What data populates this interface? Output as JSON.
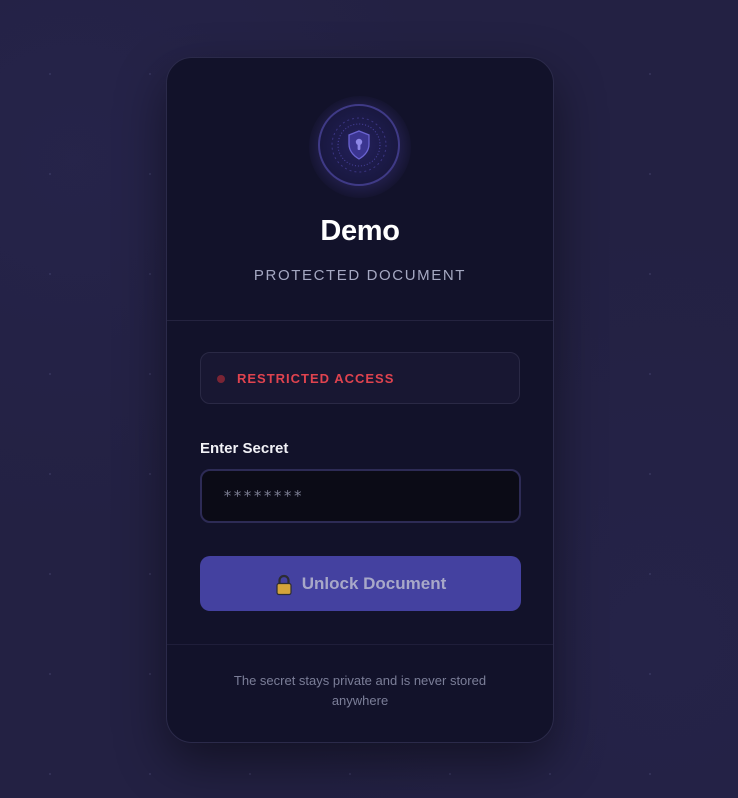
{
  "card": {
    "title": "Demo",
    "subtitle": "PROTECTED DOCUMENT",
    "emblem_icon": "shield-lock-icon"
  },
  "status": {
    "text": "RESTRICTED ACCESS",
    "color": "#e0434f"
  },
  "form": {
    "secret_label": "Enter Secret",
    "secret_placeholder": "********",
    "secret_value": "",
    "unlock_label": "Unlock Document",
    "unlock_icon": "lock-icon"
  },
  "footer": {
    "text": "The secret stays private and is never stored anywhere"
  },
  "colors": {
    "accent": "#4441a0",
    "background": "#232143",
    "card": "#12122a"
  }
}
